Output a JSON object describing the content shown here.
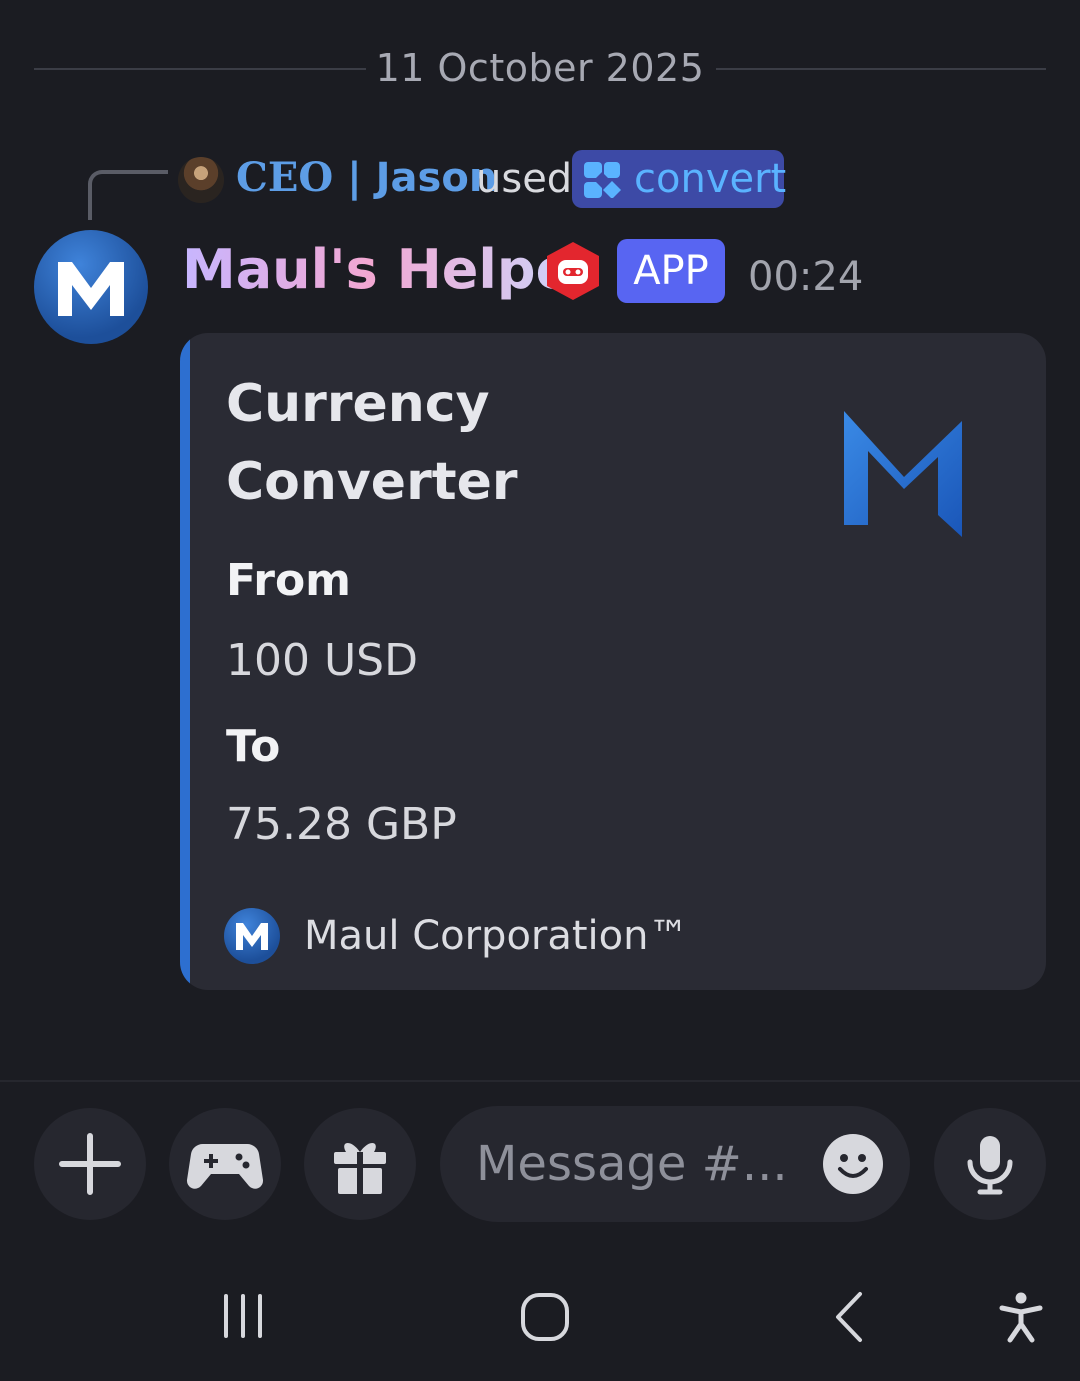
{
  "date_divider": "11 October 2025",
  "reply": {
    "user_prefix": "CEO",
    "user_sep": "|",
    "user_name": "Jason",
    "used_text": "used",
    "command": "convert"
  },
  "bot": {
    "name": "Maul's Helper",
    "tag": "APP",
    "timestamp": "00:24",
    "avatar_letter": "M"
  },
  "embed": {
    "title": "Currency Converter",
    "fields": [
      {
        "name": "From",
        "value": "100 USD"
      },
      {
        "name": "To",
        "value": "75.28 GBP"
      }
    ],
    "footer": "Maul Corporation™",
    "accent_color": "#2d6fd0"
  },
  "composer": {
    "placeholder": "Message #..."
  },
  "colors": {
    "background": "#1b1c22",
    "app_tag": "#5865f2",
    "command_pill": "#3d4aa6",
    "username": "#5d9de6"
  },
  "icons": [
    "plus-icon",
    "gamepad-icon",
    "gift-icon",
    "emoji-icon",
    "microphone-icon",
    "recent-apps-icon",
    "home-icon",
    "back-icon",
    "accessibility-icon"
  ]
}
